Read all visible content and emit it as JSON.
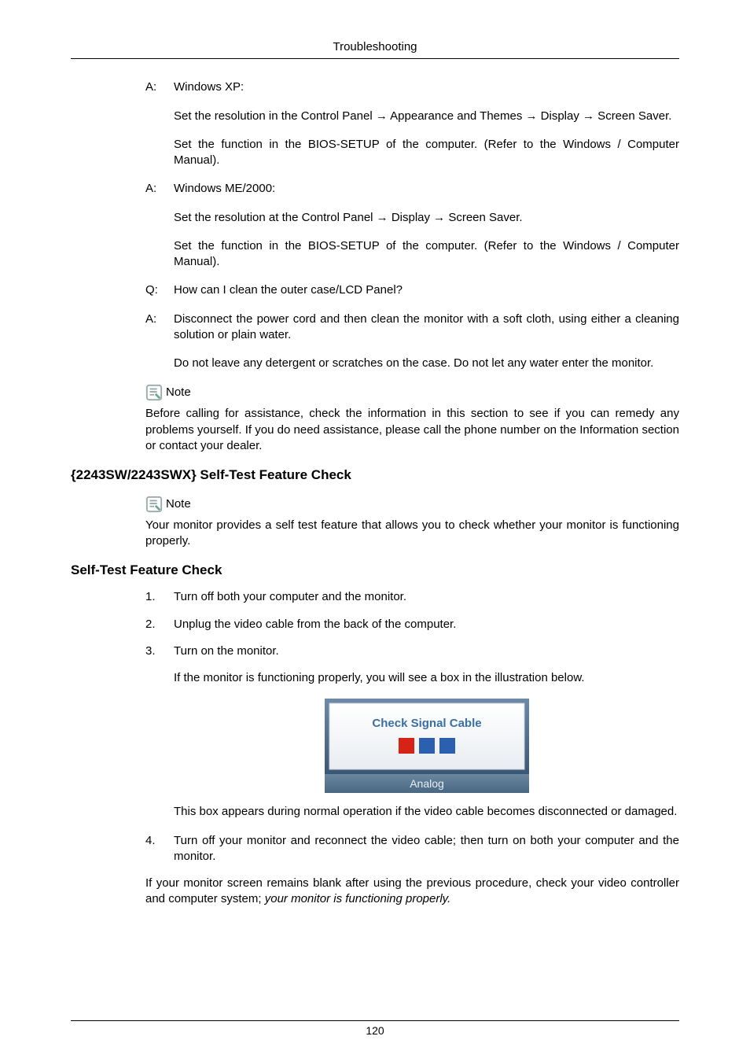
{
  "header": {
    "running": "Troubleshooting"
  },
  "qa": [
    {
      "label": "A:",
      "body": "Windows XP:"
    },
    {
      "indent": "Set the resolution in the Control Panel → Appearance and Themes → Display → Screen Saver."
    },
    {
      "indent": "Set the function in the BIOS-SETUP of the computer. (Refer to the Windows / Computer Manual)."
    },
    {
      "label": "A:",
      "body": "Windows ME/2000:"
    },
    {
      "indent": "Set the resolution at the Control Panel → Display → Screen Saver."
    },
    {
      "indent": "Set the function in the BIOS-SETUP of the computer. (Refer to the Windows / Computer Manual)."
    },
    {
      "label": "Q:",
      "body": "How can I clean the outer case/LCD Panel?"
    },
    {
      "label": "A:",
      "body": "Disconnect the power cord and then clean the monitor with a soft cloth, using either a cleaning solution or plain water."
    },
    {
      "indent": "Do not leave any detergent or scratches on the case. Do not let any water enter the monitor."
    }
  ],
  "note1": {
    "label": "Note",
    "body": "Before calling for assistance, check the information in this section to see if you can remedy any problems yourself. If you do need assistance, please call the phone number on the Information section or contact your dealer."
  },
  "section1": {
    "title": "{2243SW/2243SWX} Self-Test Feature Check"
  },
  "note2": {
    "label": "Note",
    "body": "Your monitor provides a self test feature that allows you to check whether your monitor is functioning properly."
  },
  "section2": {
    "title": "Self-Test Feature Check"
  },
  "steps": [
    {
      "num": "1.",
      "body": "Turn off both your computer and the monitor."
    },
    {
      "num": "2.",
      "body": "Unplug the video cable from the back of the computer."
    },
    {
      "num": "3.",
      "body": "Turn on the monitor."
    },
    {
      "sub": "If the monitor is functioning properly, you will see a box in the illustration below."
    }
  ],
  "figure": {
    "caption": "Check Signal Cable",
    "footer": "Analog"
  },
  "afterFigure": {
    "p1": "This box appears during normal operation if the video cable becomes disconnected or damaged.",
    "step4num": "4.",
    "step4body": "Turn off your monitor and reconnect the video cable; then turn on both your computer and the monitor.",
    "p2a": "If your monitor screen remains blank after using the previous procedure, check your video controller and computer system; ",
    "p2b": "your monitor is functioning properly."
  },
  "footer": {
    "page": "120"
  }
}
